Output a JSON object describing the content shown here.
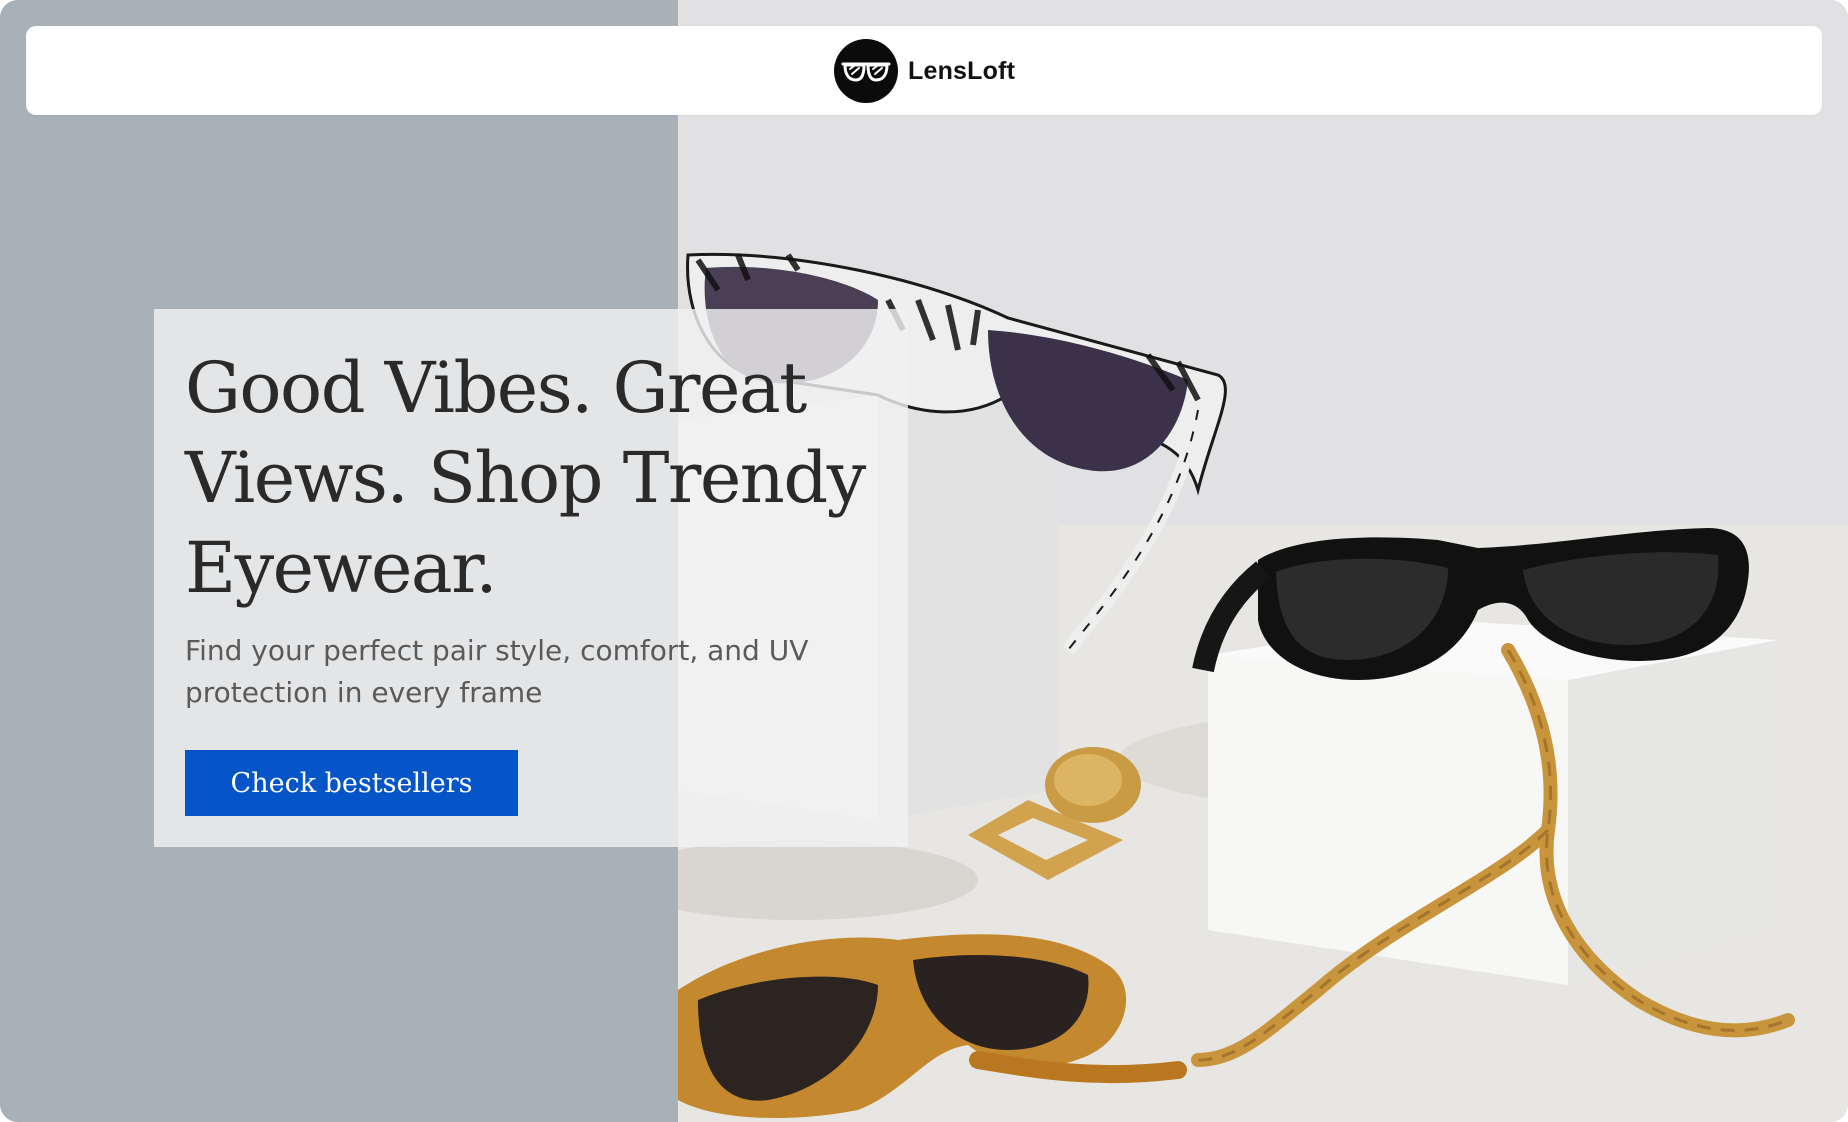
{
  "header": {
    "brand_name": "LensLoft",
    "logo_icon": "sunglasses-icon"
  },
  "hero": {
    "title": "Good Vibes. Great Views. Shop Trendy Eyewear.",
    "subtitle": "Find your perfect pair style, comfort, and UV protection in every frame",
    "cta_label": "Check bestsellers"
  },
  "colors": {
    "left_panel": "#a9b1b8",
    "cta_background": "#0655c8",
    "cta_text": "#ffffff",
    "title_text": "#2a2a2a",
    "subtitle_text": "#5a5a5a"
  }
}
